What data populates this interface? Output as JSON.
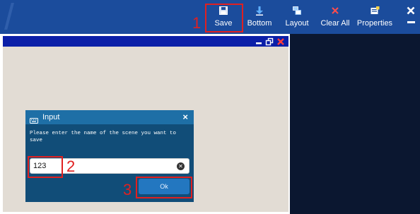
{
  "toolbar": {
    "save_label": "Save",
    "bottom_label": "Bottom",
    "layout_label": "Layout",
    "clear_all_label": "Clear All",
    "properties_label": "Properties"
  },
  "dialog": {
    "title": "Input",
    "close_glyph": "×",
    "message": "Please enter the name of the scene you want to save",
    "input_value": "123",
    "ok_label": "Ok"
  },
  "annotations": {
    "step1": "1",
    "step2": "2",
    "step3": "3"
  },
  "colors": {
    "toolbar_bg": "#1b4c9c",
    "window_titlebar": "#0b1fa8",
    "canvas_bg": "#e2dcd4",
    "right_panel_bg": "#0b1730",
    "dialog_bg": "#114d78",
    "dialog_header": "#1e6fa6",
    "annotation_red": "#e02020"
  },
  "icons": [
    "floppy-save-icon",
    "arrow-down-icon",
    "layout-icon",
    "clear-x-icon",
    "properties-icon",
    "close-x-icon",
    "minimize-icon",
    "keyboard-icon",
    "clear-input-icon",
    "restore-icon"
  ]
}
